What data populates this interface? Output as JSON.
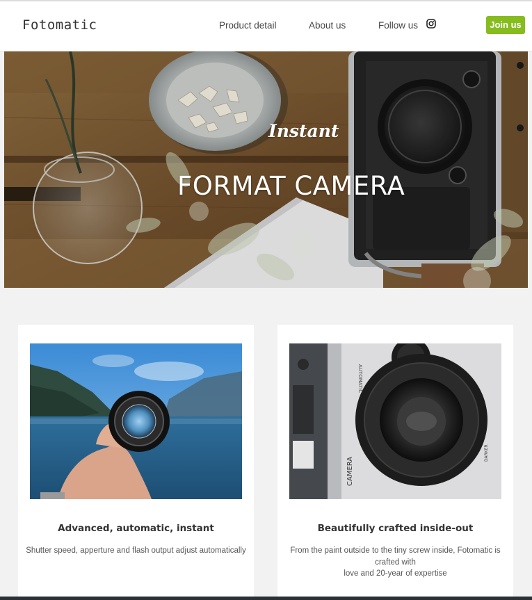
{
  "navbar": {
    "brand": "Fotomatic",
    "links": [
      {
        "label": "Product detail"
      },
      {
        "label": "About us"
      },
      {
        "label": "Follow us"
      }
    ],
    "social_icon": "instagram-icon",
    "join_label": "Join us",
    "accent_color": "#86bc1e"
  },
  "hero": {
    "subtitle": "Instant",
    "title": "FORMAT CAMERA"
  },
  "features": [
    {
      "image": "hand-holding-lens-over-lake",
      "title": "Advanced, automatic, instant",
      "lines": [
        "Shutter speed, apperture and flash output adjust automatically"
      ]
    },
    {
      "image": "camera-lens-closeup",
      "title": "Beautifully crafted inside-out",
      "lines": [
        "From the paint outside to the tiny screw inside, Fotomatic is",
        "crafted with",
        "love and 20-year of expertise"
      ]
    }
  ]
}
